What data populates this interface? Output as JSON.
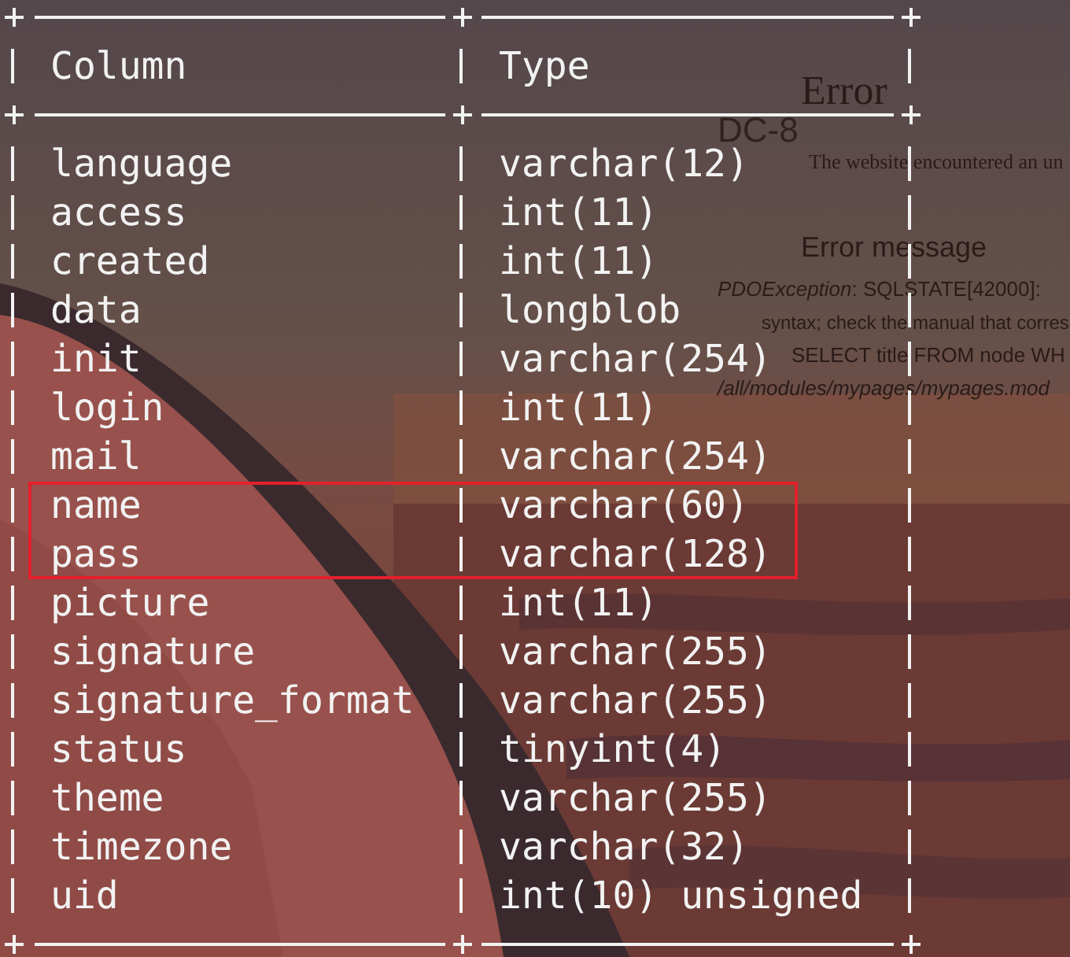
{
  "background_window": {
    "texts": [
      {
        "kind": "heading",
        "text": "Error"
      },
      {
        "kind": "site",
        "text": "DC-8"
      },
      {
        "kind": "body",
        "text": "The website encountered an un"
      },
      {
        "kind": "subheading",
        "text": "Error message"
      },
      {
        "kind": "error",
        "text": "*PDOException*: SQLSTATE[42000]:"
      },
      {
        "kind": "error",
        "text": "syntax; check the manual that corres"
      },
      {
        "kind": "error-indent",
        "text": "SELECT title FROM node WH"
      },
      {
        "kind": "path",
        "text": "/all/modules/mypages/mypages.mod"
      }
    ]
  },
  "table": {
    "columns": [
      "Column",
      "Type"
    ],
    "rows": [
      {
        "column": "language",
        "type": "varchar(12)",
        "highlighted": false
      },
      {
        "column": "access",
        "type": "int(11)",
        "highlighted": false
      },
      {
        "column": "created",
        "type": "int(11)",
        "highlighted": false
      },
      {
        "column": "data",
        "type": "longblob",
        "highlighted": false
      },
      {
        "column": "init",
        "type": "varchar(254)",
        "highlighted": false
      },
      {
        "column": "login",
        "type": "int(11)",
        "highlighted": false
      },
      {
        "column": "mail",
        "type": "varchar(254)",
        "highlighted": false
      },
      {
        "column": "name",
        "type": "varchar(60)",
        "highlighted": true
      },
      {
        "column": "pass",
        "type": "varchar(128)",
        "highlighted": true
      },
      {
        "column": "picture",
        "type": "int(11)",
        "highlighted": false
      },
      {
        "column": "signature",
        "type": "varchar(255)",
        "highlighted": false
      },
      {
        "column": "signature_format",
        "type": "varchar(255)",
        "highlighted": false
      },
      {
        "column": "status",
        "type": "tinyint(4)",
        "highlighted": false
      },
      {
        "column": "theme",
        "type": "varchar(255)",
        "highlighted": false
      },
      {
        "column": "timezone",
        "type": "varchar(32)",
        "highlighted": false
      },
      {
        "column": "uid",
        "type": "int(10) unsigned",
        "highlighted": false
      }
    ]
  }
}
